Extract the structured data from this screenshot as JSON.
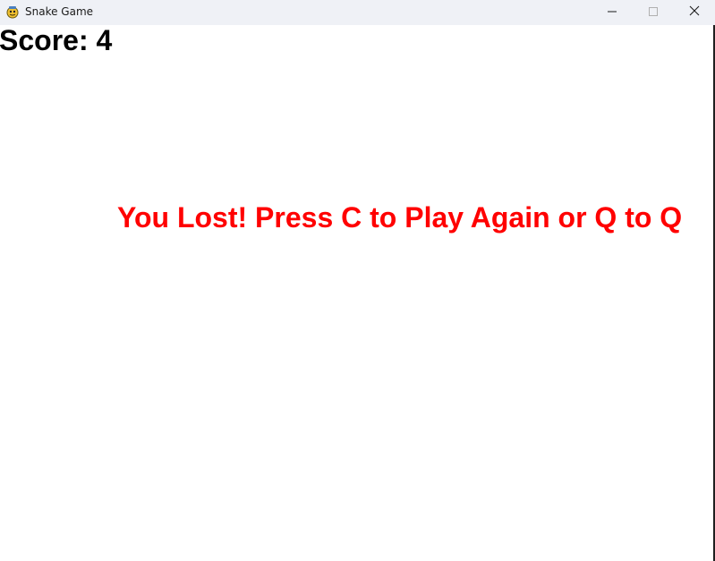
{
  "window": {
    "title": "Snake Game",
    "icon": "pygame-snake-icon"
  },
  "controls": {
    "minimize_icon": "minimize-icon",
    "maximize_icon": "maximize-icon",
    "close_icon": "close-icon"
  },
  "game": {
    "score_text": "Score: 4",
    "message_text": "You Lost! Press C to Play Again or Q to Q",
    "message_color": "#ff0000",
    "score_color": "#000000",
    "background_color": "#ffffff"
  }
}
